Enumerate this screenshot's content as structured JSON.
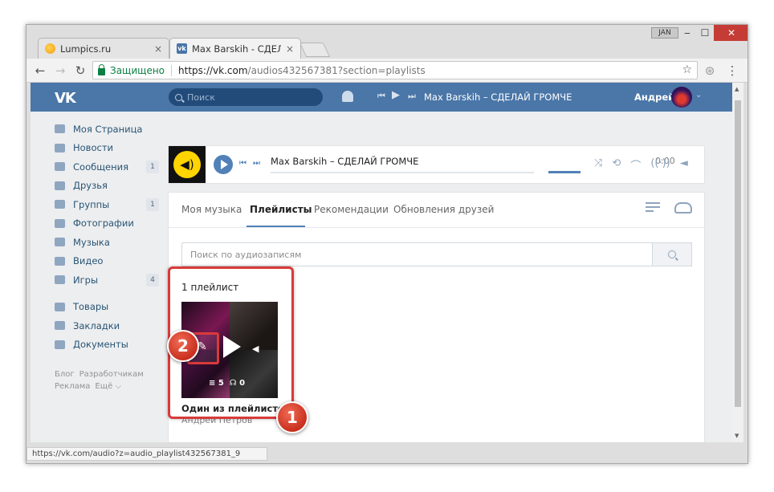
{
  "browser": {
    "tabs": [
      {
        "label": "Lumpics.ru",
        "close": "×"
      },
      {
        "label": "Max Barskih - СДЕЛАЙ Г",
        "close": "×"
      }
    ],
    "user_tag": "JAN",
    "secure_label": "Защищено",
    "url_host": "https://vk.com",
    "url_path": "/audios432567381?section=playlists",
    "status_url": "https://vk.com/audio?z=audio_playlist432567381_9"
  },
  "header": {
    "logo": "VK",
    "search_placeholder": "Поиск",
    "now_playing": "Max Barskih – СДЕЛАЙ ГРОМЧЕ",
    "user_name": "Андрей"
  },
  "menu": {
    "items": [
      {
        "label": "Моя Страница",
        "icon": "home-icon",
        "badge": ""
      },
      {
        "label": "Новости",
        "icon": "news-icon",
        "badge": ""
      },
      {
        "label": "Сообщения",
        "icon": "messages-icon",
        "badge": "1"
      },
      {
        "label": "Друзья",
        "icon": "friends-icon",
        "badge": ""
      },
      {
        "label": "Группы",
        "icon": "groups-icon",
        "badge": "1"
      },
      {
        "label": "Фотографии",
        "icon": "photos-icon",
        "badge": ""
      },
      {
        "label": "Музыка",
        "icon": "music-icon",
        "badge": ""
      },
      {
        "label": "Видео",
        "icon": "video-icon",
        "badge": ""
      },
      {
        "label": "Игры",
        "icon": "games-icon",
        "badge": "4"
      }
    ],
    "items2": [
      {
        "label": "Товары",
        "icon": "goods-icon"
      },
      {
        "label": "Закладки",
        "icon": "bookmarks-icon"
      },
      {
        "label": "Документы",
        "icon": "documents-icon"
      }
    ],
    "footer": {
      "blog": "Блог",
      "dev": "Разработчикам",
      "ads": "Реклама",
      "more": "Ещё ⌵"
    }
  },
  "player": {
    "track": "Max Barskih – СДЕЛАЙ ГРОМЧЕ",
    "time": "0:00"
  },
  "audio": {
    "tabs": [
      "Моя музыка",
      "Плейлисты",
      "Рекомендации",
      "Обновления друзей"
    ],
    "active_tab": "Плейлисты",
    "search_placeholder": "Поиск по аудиозаписям",
    "playlist_count": "1 плейлист",
    "playlist": {
      "title": "Один из плейлистов",
      "author": "Андрей Петров",
      "tracks": "5",
      "listens": "0"
    }
  },
  "annotations": {
    "marker1": "1",
    "marker2": "2"
  },
  "colors": {
    "vk_blue": "#4a76a8",
    "accent": "#5181b8",
    "highlight": "#d93a3a"
  }
}
